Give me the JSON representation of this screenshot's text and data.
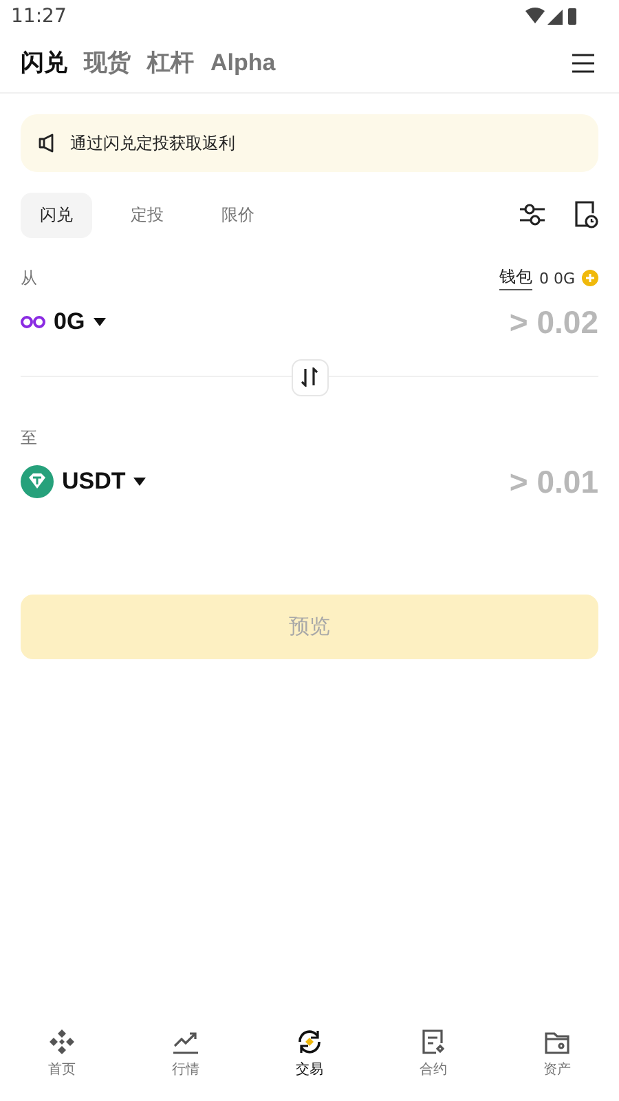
{
  "status_bar": {
    "time": "11:27"
  },
  "top_tabs": [
    {
      "label": "闪兑",
      "selected": true
    },
    {
      "label": "现货",
      "selected": false
    },
    {
      "label": "杠杆",
      "selected": false
    },
    {
      "label": "Alpha",
      "selected": false
    }
  ],
  "banner": {
    "text": "通过闪兑定投获取返利"
  },
  "mode_tabs": [
    {
      "label": "闪兑",
      "selected": true
    },
    {
      "label": "定投",
      "selected": false
    },
    {
      "label": "限价",
      "selected": false
    }
  ],
  "from": {
    "label": "从",
    "wallet_label": "钱包",
    "balance": "0 0G",
    "token": "0G",
    "placeholder": "> 0.02"
  },
  "to": {
    "label": "至",
    "token": "USDT",
    "placeholder": "> 0.01"
  },
  "preview_button": {
    "label": "预览",
    "disabled": true
  },
  "bottom_nav": [
    {
      "label": "首页",
      "selected": false
    },
    {
      "label": "行情",
      "selected": false
    },
    {
      "label": "交易",
      "selected": true
    },
    {
      "label": "合约",
      "selected": false
    },
    {
      "label": "资产",
      "selected": false
    }
  ]
}
